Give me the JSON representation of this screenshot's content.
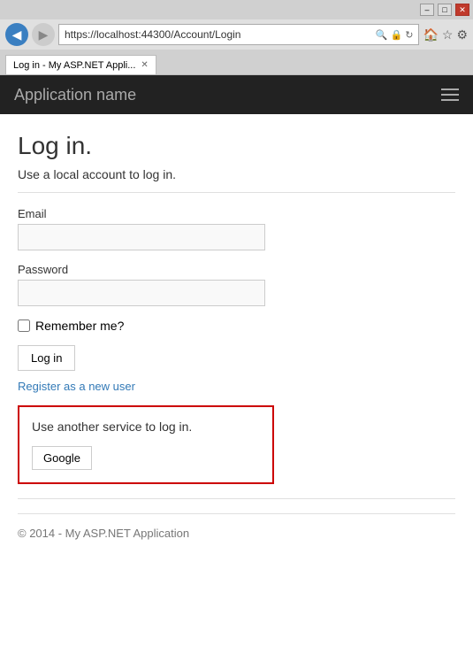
{
  "browser": {
    "title_bar": {
      "minimize": "–",
      "maximize": "□",
      "close": "✕"
    },
    "address": "https://localhost:44300/Account/Login",
    "tab_label": "Log in - My ASP.NET Appli...",
    "back_icon": "◀",
    "forward_icon": "▶"
  },
  "navbar": {
    "app_name": "Application name",
    "hamburger_label": "Menu"
  },
  "page": {
    "title": "Log in.",
    "subtitle": "Use a local account to log in.",
    "email_label": "Email",
    "email_placeholder": "",
    "password_label": "Password",
    "password_placeholder": "",
    "remember_me_label": "Remember me?",
    "login_button": "Log in",
    "register_link": "Register as a new user",
    "external_login_title": "Use another service to log in.",
    "google_button": "Google",
    "footer_text": "© 2014 - My ASP.NET Application"
  }
}
